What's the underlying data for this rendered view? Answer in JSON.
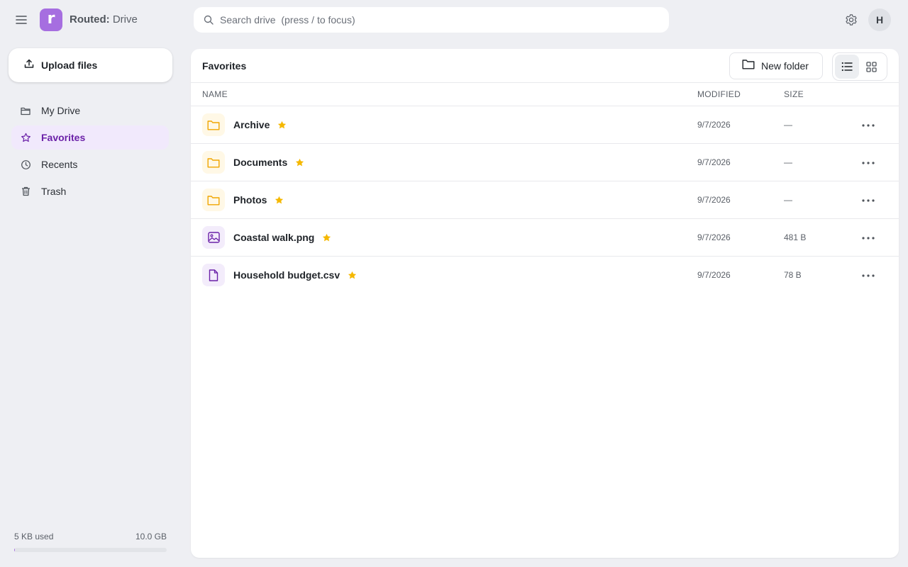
{
  "app": {
    "brand_bold": "Routed:",
    "brand_rest": " Drive",
    "logo_letter": "r",
    "accent_color": "#a66ee0"
  },
  "search": {
    "placeholder": "Search drive  (press / to focus)",
    "value": ""
  },
  "user": {
    "initial": "H"
  },
  "sidebar": {
    "upload_label": "Upload files",
    "items": [
      {
        "label": "My Drive",
        "icon": "folder-icon",
        "active": false
      },
      {
        "label": "Favorites",
        "icon": "star-icon",
        "active": true
      },
      {
        "label": "Recents",
        "icon": "clock-icon",
        "active": false
      },
      {
        "label": "Trash",
        "icon": "trash-icon",
        "active": false
      }
    ],
    "storage": {
      "used": "5 KB used",
      "total": "10.0 GB",
      "fraction": 0.0005
    }
  },
  "main": {
    "title": "Favorites",
    "new_folder_label": "New folder",
    "view_mode": "list",
    "columns": {
      "name": "NAME",
      "modified": "MODIFIED",
      "size": "SIZE"
    },
    "files": [
      {
        "name": "Archive",
        "type": "folder",
        "modified": "9/7/2026",
        "size": "—",
        "starred": true
      },
      {
        "name": "Documents",
        "type": "folder",
        "modified": "9/7/2026",
        "size": "—",
        "starred": true
      },
      {
        "name": "Photos",
        "type": "folder",
        "modified": "9/7/2026",
        "size": "—",
        "starred": true
      },
      {
        "name": "Coastal walk.png",
        "type": "image",
        "modified": "9/7/2026",
        "size": "481 B",
        "starred": true
      },
      {
        "name": "Household budget.csv",
        "type": "doc",
        "modified": "9/7/2026",
        "size": "78 B",
        "starred": true
      }
    ]
  }
}
